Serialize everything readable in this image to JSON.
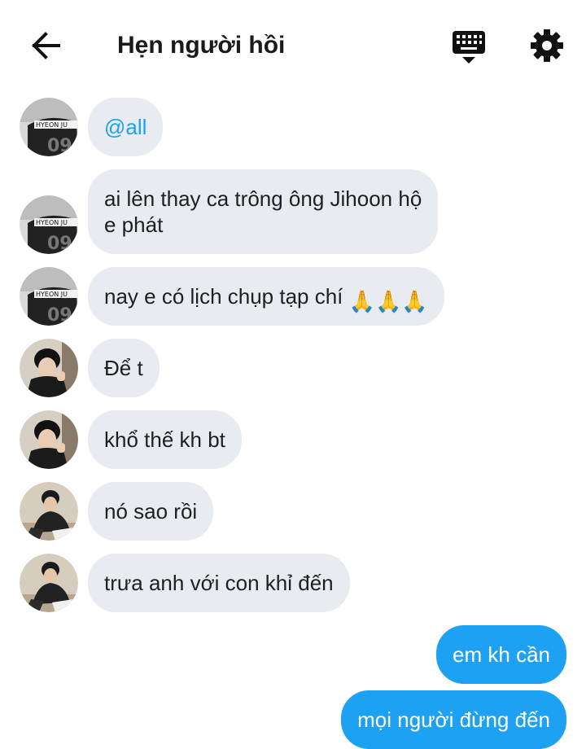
{
  "header": {
    "title": "Hẹn người hồi",
    "back_icon": "arrow-left-icon",
    "keyboard_icon": "keyboard-icon",
    "settings_icon": "gear-icon"
  },
  "colors": {
    "incoming_bubble": "#e8ecf0",
    "outgoing_bubble": "#1da1f2",
    "mention": "#1da1f2"
  },
  "messages": [
    {
      "sender": "user-jersey",
      "text": "@all"
    },
    {
      "sender": "user-jersey",
      "line1": "ai lên thay ca trông ông Jihoon hộ",
      "line2": "e phát"
    },
    {
      "sender": "user-jersey",
      "text": "nay e có lịch chụp tạp chí",
      "emoji": "🙏🙏🙏"
    },
    {
      "sender": "user-suit",
      "text": "Để t"
    },
    {
      "sender": "user-suit",
      "text": "khổ thế kh bt"
    },
    {
      "sender": "user-cafe",
      "text": "nó sao rồi"
    },
    {
      "sender": "user-cafe",
      "text": "trưa anh với con khỉ đến"
    },
    {
      "sender": "me",
      "text": "em kh cần"
    },
    {
      "sender": "me",
      "text": "mọi người đừng đến"
    }
  ]
}
